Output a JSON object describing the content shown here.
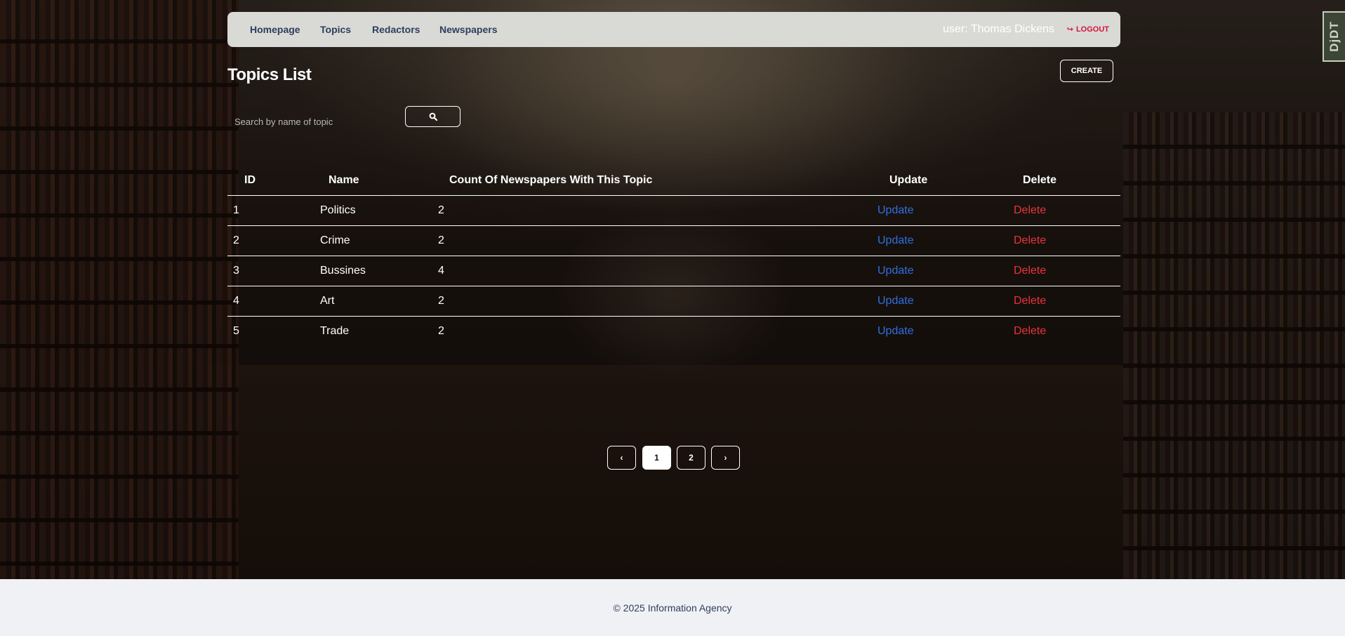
{
  "nav": {
    "links": [
      {
        "label": "Homepage"
      },
      {
        "label": "Topics"
      },
      {
        "label": "Redactors"
      },
      {
        "label": "Newspapers"
      }
    ],
    "user_text": "user: Thomas Dickens",
    "logout_label": "LOGOUT",
    "logout_icon": "sign-out-icon",
    "accent_color": "#d6143a"
  },
  "page": {
    "title": "Topics List",
    "create_label": "CREATE"
  },
  "search": {
    "placeholder": "Search by name of topic",
    "value": "",
    "button_icon": "search-icon"
  },
  "table": {
    "headers": {
      "id": "ID",
      "name": "Name",
      "count": "Count Of Newspapers With This Topic",
      "update": "Update",
      "delete": "Delete"
    },
    "rows": [
      {
        "id": "1",
        "name": "Politics",
        "count": "2",
        "update": "Update",
        "delete": "Delete"
      },
      {
        "id": "2",
        "name": "Crime",
        "count": "2",
        "update": "Update",
        "delete": "Delete"
      },
      {
        "id": "3",
        "name": "Bussines",
        "count": "4",
        "update": "Update",
        "delete": "Delete"
      },
      {
        "id": "4",
        "name": "Art",
        "count": "2",
        "update": "Update",
        "delete": "Delete"
      },
      {
        "id": "5",
        "name": "Trade",
        "count": "2",
        "update": "Update",
        "delete": "Delete"
      }
    ],
    "update_color": "#2f6fe0",
    "delete_color": "#e8343a"
  },
  "pagination": {
    "prev": "‹",
    "pages": [
      "1",
      "2"
    ],
    "current": "1",
    "next": "›"
  },
  "footer": {
    "text": "© 2025 Information Agency"
  },
  "debug_toolbar": {
    "label": "DjDT"
  }
}
